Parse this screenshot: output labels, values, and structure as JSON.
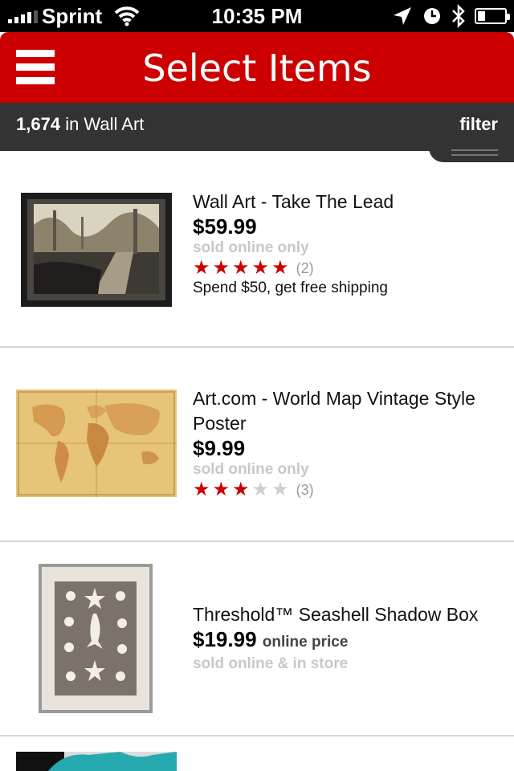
{
  "status_bar": {
    "carrier": "Sprint",
    "time": "10:35 PM"
  },
  "header": {
    "title": "Select Items"
  },
  "results": {
    "count": "1,674",
    "category_text": "in Wall Art",
    "filter_label": "filter"
  },
  "products": [
    {
      "title": "Wall Art - Take The Lead",
      "price": "$59.99",
      "availability": "sold online only",
      "rating": 5,
      "reviews": "(2)",
      "promo": "Spend $50, get free shipping"
    },
    {
      "title": "Art.com - World Map Vintage Style Poster",
      "price": "$9.99",
      "availability": "sold online only",
      "rating": 3,
      "reviews": "(3)"
    },
    {
      "title": "Threshold™ Seashell Shadow Box",
      "price": "$19.99",
      "price_note": "online price",
      "availability": "sold online & in store"
    }
  ],
  "colors": {
    "brand_red": "#cc0000",
    "sub_bar": "#333333",
    "muted_text": "#c8c8c8"
  }
}
